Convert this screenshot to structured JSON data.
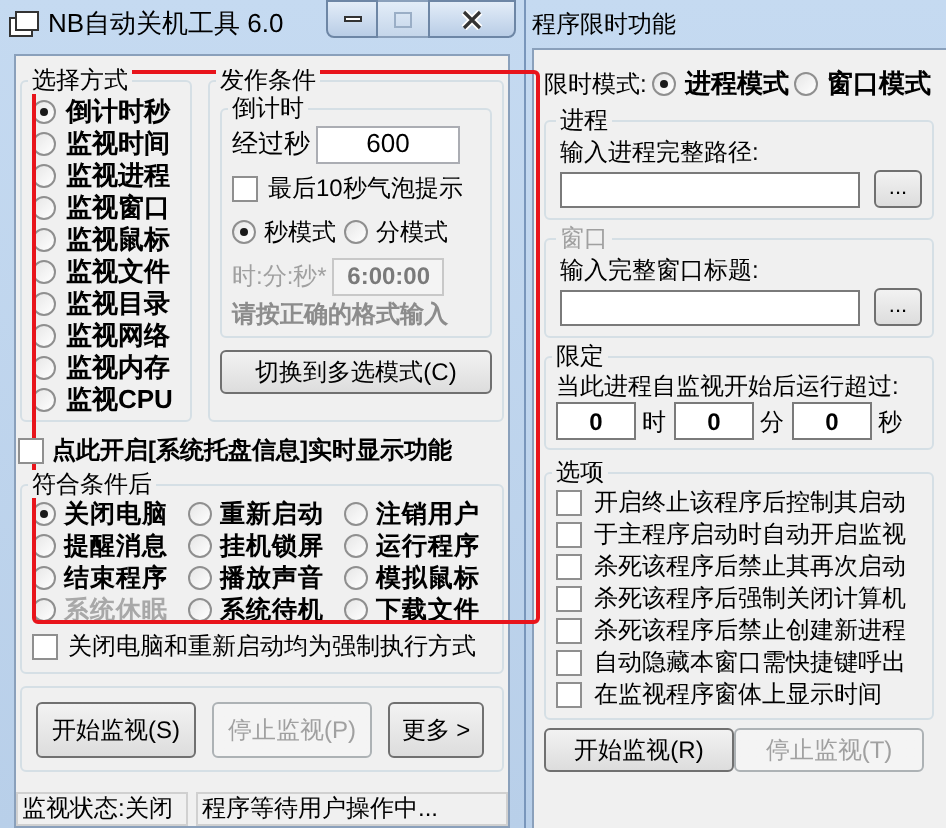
{
  "left_window": {
    "title": "NB自动关机工具 6.0",
    "mode_group": {
      "title": "选择方式",
      "options": [
        {
          "label": "倒计时秒",
          "selected": true
        },
        {
          "label": "监视时间",
          "selected": false
        },
        {
          "label": "监视进程",
          "selected": false
        },
        {
          "label": "监视窗口",
          "selected": false
        },
        {
          "label": "监视鼠标",
          "selected": false
        },
        {
          "label": "监视文件",
          "selected": false
        },
        {
          "label": "监视目录",
          "selected": false
        },
        {
          "label": "监视网络",
          "selected": false
        },
        {
          "label": "监视内存",
          "selected": false
        },
        {
          "label": "监视CPU",
          "selected": false
        }
      ]
    },
    "trigger_group": {
      "title": "发作条件",
      "countdown": {
        "title": "倒计时",
        "seconds_label": "经过秒",
        "seconds_value": "600",
        "bubble_checkbox": {
          "label": "最后10秒气泡提示",
          "checked": false
        },
        "units": [
          {
            "label": "秒模式",
            "selected": true
          },
          {
            "label": "分模式",
            "selected": false
          }
        ],
        "time_label": "时:分:秒*",
        "time_value": "6:00:00",
        "hint": "请按正确的格式输入"
      },
      "switch_button": "切换到多选模式(C)"
    },
    "tray_checkbox": {
      "label": "点此开启[系统托盘信息]实时显示功能",
      "checked": false
    },
    "action_group": {
      "title": "符合条件后",
      "actions": [
        {
          "label": "关闭电脑",
          "selected": true,
          "disabled": false
        },
        {
          "label": "重新启动",
          "selected": false,
          "disabled": false
        },
        {
          "label": "注销用户",
          "selected": false,
          "disabled": false
        },
        {
          "label": "提醒消息",
          "selected": false,
          "disabled": false
        },
        {
          "label": "挂机锁屏",
          "selected": false,
          "disabled": false
        },
        {
          "label": "运行程序",
          "selected": false,
          "disabled": false
        },
        {
          "label": "结束程序",
          "selected": false,
          "disabled": false
        },
        {
          "label": "播放声音",
          "selected": false,
          "disabled": false
        },
        {
          "label": "模拟鼠标",
          "selected": false,
          "disabled": false
        },
        {
          "label": "系统休眠",
          "selected": false,
          "disabled": true
        },
        {
          "label": "系统待机",
          "selected": false,
          "disabled": false
        },
        {
          "label": "下载文件",
          "selected": false,
          "disabled": false
        }
      ],
      "force_checkbox": {
        "label": "关闭电脑和重新启动均为强制执行方式",
        "checked": false
      }
    },
    "buttons": [
      {
        "label": "开始监视(S)",
        "disabled": false
      },
      {
        "label": "停止监视(P)",
        "disabled": true
      },
      {
        "label": "更多 >",
        "disabled": false
      }
    ],
    "status_bar": [
      "监视状态:关闭",
      "程序等待用户操作中..."
    ]
  },
  "right_window": {
    "title": "程序限时功能",
    "mode_label": "限时模式:",
    "modes": [
      {
        "label": "进程模式",
        "selected": true
      },
      {
        "label": "窗口模式",
        "selected": false
      }
    ],
    "process_group": {
      "title": "进程",
      "label": "输入进程完整路径:",
      "browse_button": "...",
      "disabled": false
    },
    "window_group": {
      "title": "窗口",
      "label": "输入完整窗口标题:",
      "browse_button": "...",
      "disabled": true
    },
    "limit_group": {
      "title": "限定",
      "label": "当此进程自监视开始后运行超过:",
      "fields": [
        {
          "value": "0",
          "unit": "时"
        },
        {
          "value": "0",
          "unit": "分"
        },
        {
          "value": "0",
          "unit": "秒"
        }
      ]
    },
    "options_group": {
      "title": "选项",
      "items": [
        {
          "label": "开启终止该程序后控制其启动",
          "checked": false
        },
        {
          "label": "于主程序启动时自动开启监视",
          "checked": false
        },
        {
          "label": "杀死该程序后禁止其再次启动",
          "checked": false
        },
        {
          "label": "杀死该程序后强制关闭计算机",
          "checked": false
        },
        {
          "label": "杀死该程序后禁止创建新进程",
          "checked": false
        },
        {
          "label": "自动隐藏本窗口需快捷键呼出",
          "checked": false
        },
        {
          "label": "在监视程序窗体上显示时间",
          "checked": false
        }
      ]
    },
    "buttons": [
      {
        "label": "开始监视(R)",
        "disabled": false
      },
      {
        "label": "停止监视(T)",
        "disabled": true
      }
    ]
  },
  "highlight_frame": {
    "shown": true
  }
}
